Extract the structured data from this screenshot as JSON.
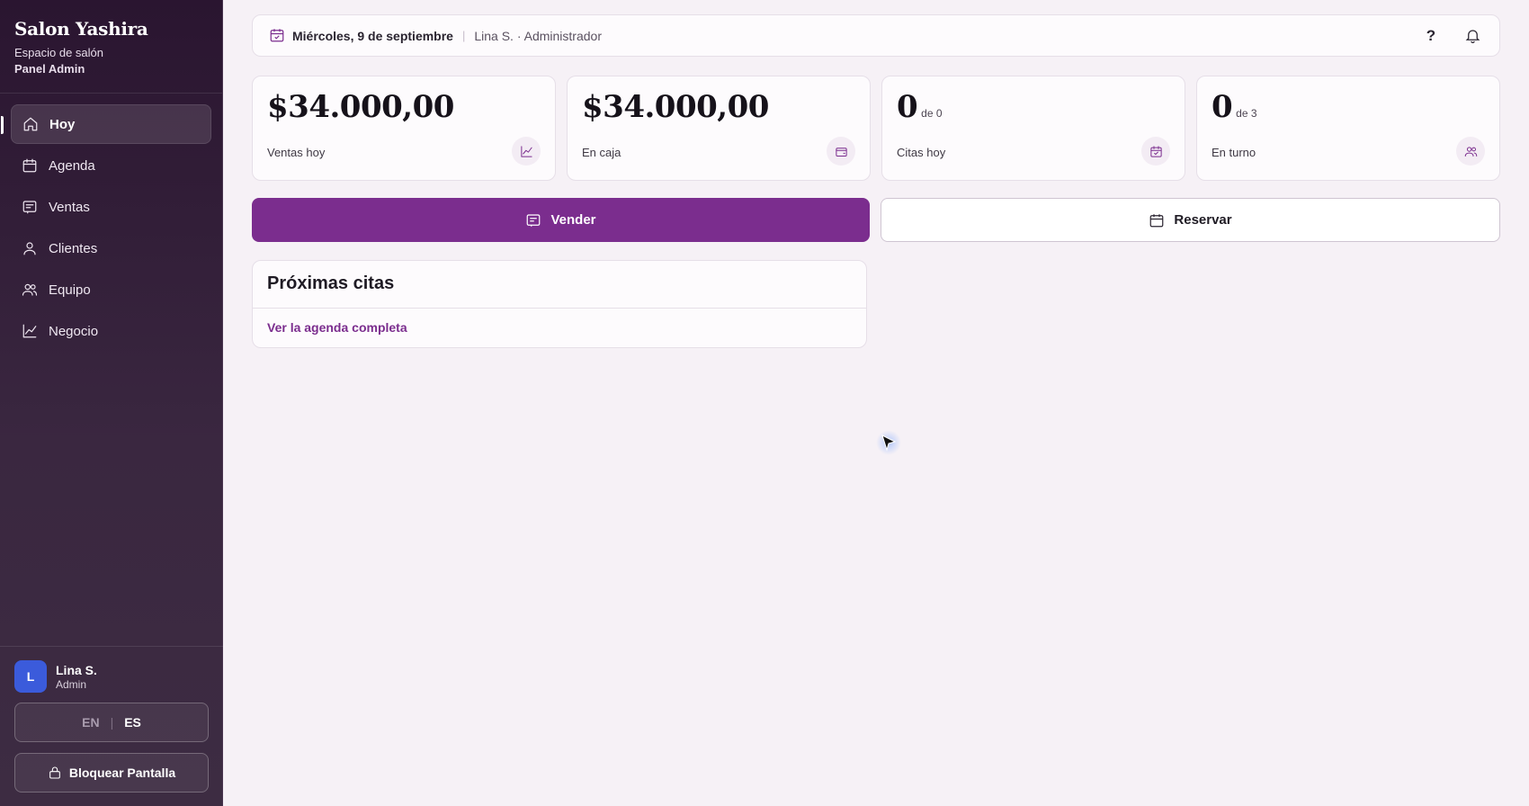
{
  "brand": {
    "name": "Salon Yashira",
    "subtitle": "Espacio de salón",
    "panel": "Panel Admin"
  },
  "nav": [
    {
      "label": "Hoy",
      "icon": "home-icon",
      "active": true
    },
    {
      "label": "Agenda",
      "icon": "calendar-icon"
    },
    {
      "label": "Ventas",
      "icon": "receipt-icon"
    },
    {
      "label": "Clientes",
      "icon": "user-icon"
    },
    {
      "label": "Equipo",
      "icon": "users-icon"
    },
    {
      "label": "Negocio",
      "icon": "chart-line-icon"
    }
  ],
  "user": {
    "initial": "L",
    "name": "Lina S.",
    "role": "Admin"
  },
  "lang": {
    "en": "EN",
    "sep": "|",
    "es": "ES",
    "selected": "ES"
  },
  "lock": {
    "label": "Bloquear Pantalla"
  },
  "topbar": {
    "date": "Miércoles, 9 de septiembre",
    "sep": "|",
    "user": "Lina S. · Administrador",
    "help": "?"
  },
  "stats": [
    {
      "value": "$34.000,00",
      "suffix": "",
      "label": "Ventas hoy",
      "icon": "chart-icon"
    },
    {
      "value": "$34.000,00",
      "suffix": "",
      "label": "En caja",
      "icon": "wallet-icon"
    },
    {
      "value": "0",
      "suffix": "de 0",
      "label": "Citas hoy",
      "icon": "calendar-check-icon"
    },
    {
      "value": "0",
      "suffix": "de 3",
      "label": "En turno",
      "icon": "users-icon"
    }
  ],
  "actions": {
    "sell": "Vender",
    "book": "Reservar"
  },
  "appointments": {
    "title": "Próximas citas",
    "link": "Ver la agenda completa"
  },
  "colors": {
    "accent": "#7b2d8e",
    "sidebar": "#2a1530",
    "avatar": "#3b5bdb"
  }
}
